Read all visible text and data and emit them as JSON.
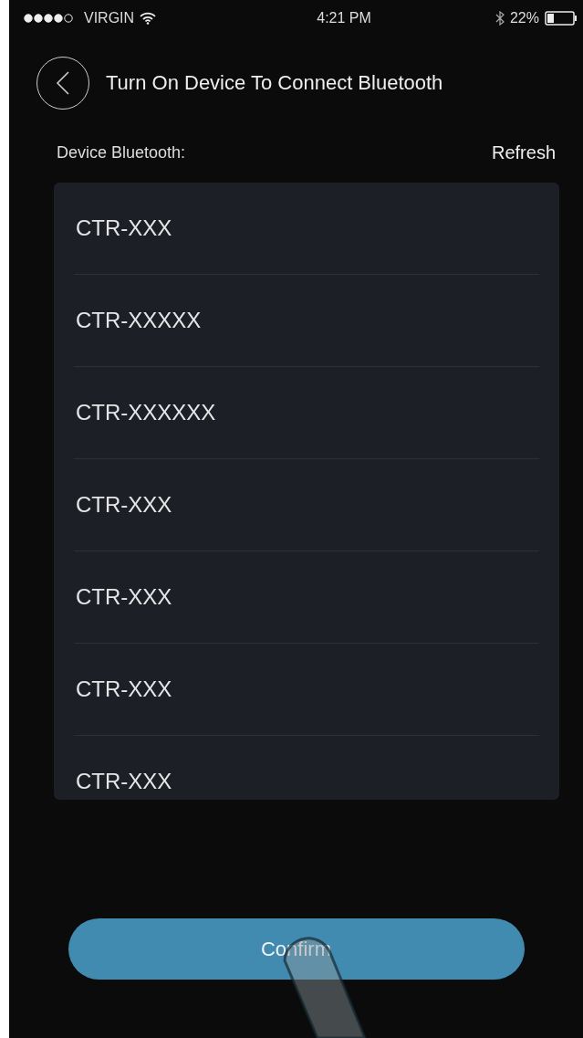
{
  "status_bar": {
    "carrier": "VIRGIN",
    "time": "4:21 PM",
    "battery": "22%"
  },
  "header": {
    "title": "Turn On Device To Connect Bluetooth"
  },
  "section": {
    "label": "Device Bluetooth:",
    "action": "Refresh"
  },
  "devices": [
    {
      "name": "CTR-XXX"
    },
    {
      "name": "CTR-XXXXX"
    },
    {
      "name": "CTR-XXXXXX"
    },
    {
      "name": "CTR-XXX"
    },
    {
      "name": "CTR-XXX"
    },
    {
      "name": "CTR-XXX"
    },
    {
      "name": "CTR-XXX"
    }
  ],
  "confirm_button": {
    "label": "Confirm"
  }
}
